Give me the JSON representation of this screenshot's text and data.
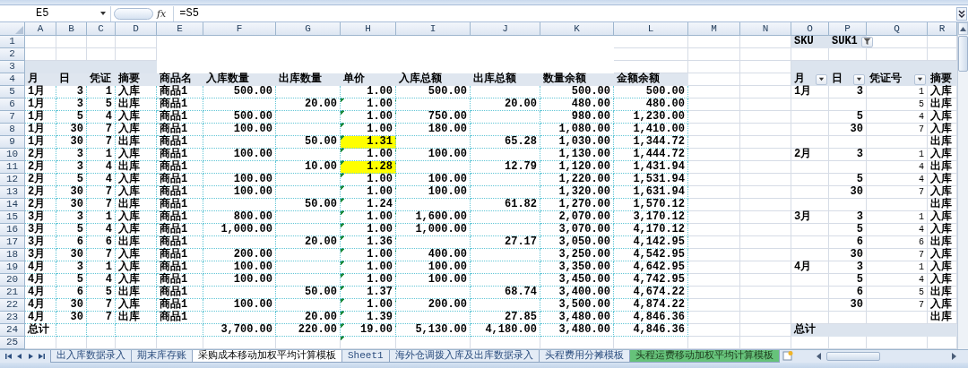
{
  "formula_bar": {
    "name_box": "E5",
    "function_button": "fx",
    "formula": "=S5"
  },
  "columns": [
    "A",
    "B",
    "C",
    "D",
    "E",
    "F",
    "G",
    "H",
    "I",
    "J",
    "K",
    "L",
    "M",
    "N",
    "O",
    "P",
    "Q",
    "R"
  ],
  "rows": [
    {
      "number": "1",
      "kind": "title",
      "highlighted": false,
      "flagged": false,
      "pivot": {
        "filter_label": "SKU",
        "filter_value": "SUK1"
      }
    },
    {
      "number": "2",
      "kind": "title",
      "highlighted": false,
      "flagged": false
    },
    {
      "number": "3",
      "kind": "band",
      "highlighted": false,
      "flagged": false
    },
    {
      "number": "4",
      "kind": "header",
      "highlighted": false,
      "flagged": false,
      "ledger": {
        "month": "月",
        "day": "日",
        "voucher": "凭证",
        "summary": "摘要",
        "product": "商品名",
        "in_qty": "入库数量",
        "out_qty": "出库数量",
        "unit_price": "单价",
        "in_amount": "入库总额",
        "out_amount": "出库总额",
        "qty_balance": "数量余额",
        "amount_balance": "金额余额"
      },
      "pivot": {
        "month": "月",
        "day": "日",
        "voucher": "凭证号",
        "summary": "摘要"
      }
    },
    {
      "number": "5",
      "kind": "data",
      "highlighted": false,
      "flagged": false,
      "ledger": {
        "month": "1月",
        "day": "3",
        "voucher": "1",
        "summary": "入库",
        "product": "商品1",
        "in_qty": "500.00",
        "unit_price": "1.00",
        "in_amount": "500.00",
        "qty_balance": "500.00",
        "amount_balance": "500.00"
      },
      "pivot": {
        "month": "1月",
        "day": "3",
        "voucher": "1",
        "summary": "入库"
      }
    },
    {
      "number": "6",
      "kind": "data",
      "highlighted": false,
      "flagged": true,
      "ledger": {
        "month": "1月",
        "day": "3",
        "voucher": "5",
        "summary": "出库",
        "product": "商品1",
        "out_qty": "20.00",
        "unit_price": "1.00",
        "out_amount": "20.00",
        "qty_balance": "480.00",
        "amount_balance": "480.00"
      },
      "pivot": {
        "voucher": "5",
        "summary": "出库"
      }
    },
    {
      "number": "7",
      "kind": "data",
      "highlighted": false,
      "flagged": true,
      "ledger": {
        "month": "1月",
        "day": "5",
        "voucher": "4",
        "summary": "入库",
        "product": "商品1",
        "in_qty": "500.00",
        "unit_price": "1.00",
        "in_amount": "750.00",
        "qty_balance": "980.00",
        "amount_balance": "1,230.00"
      },
      "pivot": {
        "day": "5",
        "voucher": "4",
        "summary": "入库"
      }
    },
    {
      "number": "8",
      "kind": "data",
      "highlighted": false,
      "flagged": true,
      "ledger": {
        "month": "1月",
        "day": "30",
        "voucher": "7",
        "summary": "入库",
        "product": "商品1",
        "in_qty": "100.00",
        "unit_price": "1.00",
        "in_amount": "180.00",
        "qty_balance": "1,080.00",
        "amount_balance": "1,410.00"
      },
      "pivot": {
        "day": "30",
        "voucher": "7",
        "summary": "入库"
      }
    },
    {
      "number": "9",
      "kind": "data",
      "highlighted": true,
      "flagged": true,
      "ledger": {
        "month": "1月",
        "day": "30",
        "voucher": "7",
        "summary": "出库",
        "product": "商品1",
        "out_qty": "50.00",
        "unit_price": "1.31",
        "out_amount": "65.28",
        "qty_balance": "1,030.00",
        "amount_balance": "1,344.72"
      },
      "pivot": {
        "summary": "出库"
      }
    },
    {
      "number": "10",
      "kind": "data",
      "highlighted": false,
      "flagged": true,
      "ledger": {
        "month": "2月",
        "day": "3",
        "voucher": "1",
        "summary": "入库",
        "product": "商品1",
        "in_qty": "100.00",
        "unit_price": "1.00",
        "in_amount": "100.00",
        "qty_balance": "1,130.00",
        "amount_balance": "1,444.72"
      },
      "pivot": {
        "month": "2月",
        "day": "3",
        "voucher": "1",
        "summary": "入库"
      }
    },
    {
      "number": "11",
      "kind": "data",
      "highlighted": true,
      "flagged": true,
      "ledger": {
        "month": "2月",
        "day": "3",
        "voucher": "4",
        "summary": "出库",
        "product": "商品1",
        "out_qty": "10.00",
        "unit_price": "1.28",
        "out_amount": "12.79",
        "qty_balance": "1,120.00",
        "amount_balance": "1,431.94"
      },
      "pivot": {
        "voucher": "4",
        "summary": "出库"
      }
    },
    {
      "number": "12",
      "kind": "data",
      "highlighted": false,
      "flagged": true,
      "ledger": {
        "month": "2月",
        "day": "5",
        "voucher": "4",
        "summary": "入库",
        "product": "商品1",
        "in_qty": "100.00",
        "unit_price": "1.00",
        "in_amount": "100.00",
        "qty_balance": "1,220.00",
        "amount_balance": "1,531.94"
      },
      "pivot": {
        "day": "5",
        "voucher": "4",
        "summary": "入库"
      }
    },
    {
      "number": "13",
      "kind": "data",
      "highlighted": false,
      "flagged": true,
      "ledger": {
        "month": "2月",
        "day": "30",
        "voucher": "7",
        "summary": "入库",
        "product": "商品1",
        "in_qty": "100.00",
        "unit_price": "1.00",
        "in_amount": "100.00",
        "qty_balance": "1,320.00",
        "amount_balance": "1,631.94"
      },
      "pivot": {
        "day": "30",
        "voucher": "7",
        "summary": "入库"
      }
    },
    {
      "number": "14",
      "kind": "data",
      "highlighted": false,
      "flagged": true,
      "ledger": {
        "month": "2月",
        "day": "30",
        "voucher": "7",
        "summary": "出库",
        "product": "商品1",
        "out_qty": "50.00",
        "unit_price": "1.24",
        "out_amount": "61.82",
        "qty_balance": "1,270.00",
        "amount_balance": "1,570.12"
      },
      "pivot": {
        "summary": "出库"
      }
    },
    {
      "number": "15",
      "kind": "data",
      "highlighted": false,
      "flagged": true,
      "ledger": {
        "month": "3月",
        "day": "3",
        "voucher": "1",
        "summary": "入库",
        "product": "商品1",
        "in_qty": "800.00",
        "unit_price": "1.00",
        "in_amount": "1,600.00",
        "qty_balance": "2,070.00",
        "amount_balance": "3,170.12"
      },
      "pivot": {
        "month": "3月",
        "day": "3",
        "voucher": "1",
        "summary": "入库"
      }
    },
    {
      "number": "16",
      "kind": "data",
      "highlighted": false,
      "flagged": true,
      "ledger": {
        "month": "3月",
        "day": "5",
        "voucher": "4",
        "summary": "入库",
        "product": "商品1",
        "in_qty": "1,000.00",
        "unit_price": "1.00",
        "in_amount": "1,000.00",
        "qty_balance": "3,070.00",
        "amount_balance": "4,170.12"
      },
      "pivot": {
        "day": "5",
        "voucher": "4",
        "summary": "入库"
      }
    },
    {
      "number": "17",
      "kind": "data",
      "highlighted": false,
      "flagged": true,
      "ledger": {
        "month": "3月",
        "day": "6",
        "voucher": "6",
        "summary": "出库",
        "product": "商品1",
        "out_qty": "20.00",
        "unit_price": "1.36",
        "out_amount": "27.17",
        "qty_balance": "3,050.00",
        "amount_balance": "4,142.95"
      },
      "pivot": {
        "day": "6",
        "voucher": "6",
        "summary": "出库"
      }
    },
    {
      "number": "18",
      "kind": "data",
      "highlighted": false,
      "flagged": true,
      "ledger": {
        "month": "3月",
        "day": "30",
        "voucher": "7",
        "summary": "入库",
        "product": "商品1",
        "in_qty": "200.00",
        "unit_price": "1.00",
        "in_amount": "400.00",
        "qty_balance": "3,250.00",
        "amount_balance": "4,542.95"
      },
      "pivot": {
        "day": "30",
        "voucher": "7",
        "summary": "入库"
      }
    },
    {
      "number": "19",
      "kind": "data",
      "highlighted": false,
      "flagged": true,
      "ledger": {
        "month": "4月",
        "day": "3",
        "voucher": "1",
        "summary": "入库",
        "product": "商品1",
        "in_qty": "100.00",
        "unit_price": "1.00",
        "in_amount": "100.00",
        "qty_balance": "3,350.00",
        "amount_balance": "4,642.95"
      },
      "pivot": {
        "month": "4月",
        "day": "3",
        "voucher": "1",
        "summary": "入库"
      }
    },
    {
      "number": "20",
      "kind": "data",
      "highlighted": false,
      "flagged": true,
      "ledger": {
        "month": "4月",
        "day": "5",
        "voucher": "4",
        "summary": "入库",
        "product": "商品1",
        "in_qty": "100.00",
        "unit_price": "1.00",
        "in_amount": "100.00",
        "qty_balance": "3,450.00",
        "amount_balance": "4,742.95"
      },
      "pivot": {
        "day": "5",
        "voucher": "4",
        "summary": "入库"
      }
    },
    {
      "number": "21",
      "kind": "data",
      "highlighted": false,
      "flagged": true,
      "ledger": {
        "month": "4月",
        "day": "6",
        "voucher": "5",
        "summary": "出库",
        "product": "商品1",
        "out_qty": "50.00",
        "unit_price": "1.37",
        "out_amount": "68.74",
        "qty_balance": "3,400.00",
        "amount_balance": "4,674.22"
      },
      "pivot": {
        "day": "6",
        "voucher": "5",
        "summary": "出库"
      }
    },
    {
      "number": "22",
      "kind": "data",
      "highlighted": false,
      "flagged": true,
      "ledger": {
        "month": "4月",
        "day": "30",
        "voucher": "7",
        "summary": "入库",
        "product": "商品1",
        "in_qty": "100.00",
        "unit_price": "1.00",
        "in_amount": "200.00",
        "qty_balance": "3,500.00",
        "amount_balance": "4,874.22"
      },
      "pivot": {
        "day": "30",
        "voucher": "7",
        "summary": "入库"
      }
    },
    {
      "number": "23",
      "kind": "data",
      "highlighted": false,
      "flagged": true,
      "ledger": {
        "month": "4月",
        "day": "30",
        "voucher": "7",
        "summary": "出库",
        "product": "商品1",
        "out_qty": "20.00",
        "unit_price": "1.39",
        "out_amount": "27.85",
        "qty_balance": "3,480.00",
        "amount_balance": "4,846.36"
      },
      "pivot": {
        "summary": "出库"
      }
    },
    {
      "number": "24",
      "kind": "total",
      "highlighted": false,
      "flagged": true,
      "ledger": {
        "month": "总计",
        "in_qty": "3,700.00",
        "out_qty": "220.00",
        "unit_price": "19.00",
        "in_amount": "5,130.00",
        "out_amount": "4,180.00",
        "qty_balance": "3,480.00",
        "amount_balance": "4,846.36"
      },
      "pivot": {
        "month": "总计"
      }
    },
    {
      "number": "25",
      "kind": "blank",
      "highlighted": false,
      "flagged": true
    }
  ],
  "sheet_tabs": [
    {
      "label": "出入库数据录入",
      "selected": false
    },
    {
      "label": "期末库存账",
      "selected": false
    },
    {
      "label": "采购成本移动加权平均计算模板",
      "selected": true
    },
    {
      "label": "Sheet1",
      "selected": false
    },
    {
      "label": "海外仓调拨入库及出库数据录入",
      "selected": false
    },
    {
      "label": "头程费用分摊模板",
      "selected": false
    },
    {
      "label": "头程运费移动加权平均计算模板",
      "selected": false,
      "color": "#66c27a"
    }
  ]
}
